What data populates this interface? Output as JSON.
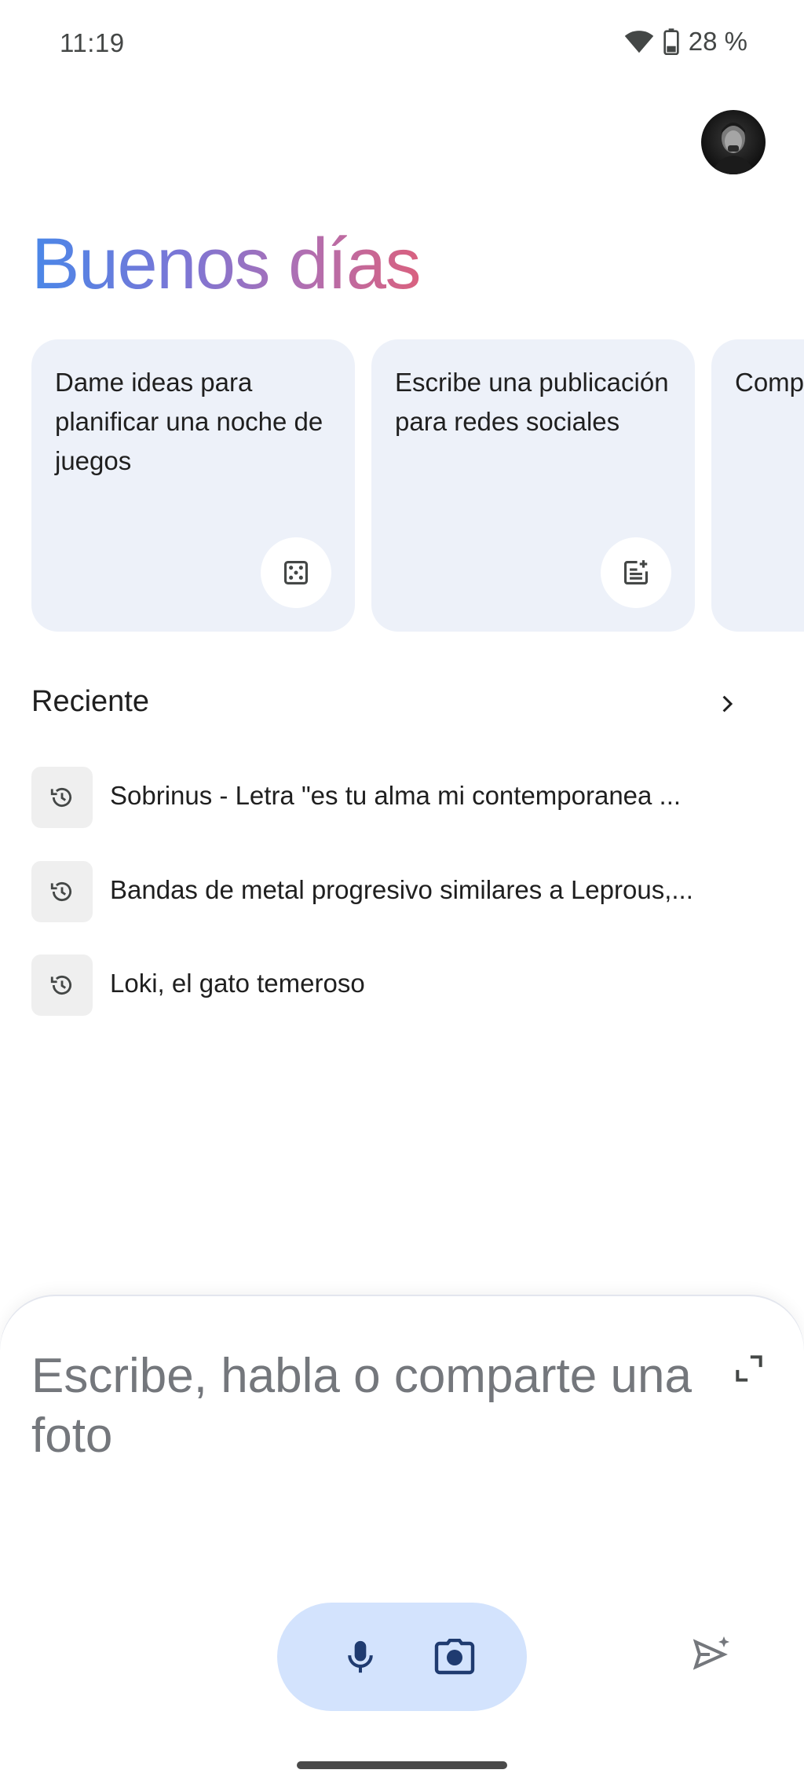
{
  "status_bar": {
    "time": "11:19",
    "battery": "28 %",
    "icons": [
      "wifi-icon",
      "battery-icon"
    ]
  },
  "greeting": "Buenos días",
  "suggestions": [
    {
      "text": "Dame ideas para planificar una noche de juegos",
      "icon": "dice-icon"
    },
    {
      "text": "Escribe una publicación para redes sociales",
      "icon": "post-add-icon"
    },
    {
      "text": "Comp difere opcio",
      "icon": ""
    }
  ],
  "recent": {
    "title": "Reciente",
    "items": [
      {
        "label": "Sobrinus - Letra \"es tu alma mi contemporanea ...",
        "icon": "history-icon"
      },
      {
        "label": "Bandas de metal progresivo similares a Leprous,...",
        "icon": "history-icon"
      },
      {
        "label": "Loki, el gato temeroso",
        "icon": "history-icon"
      }
    ]
  },
  "input": {
    "placeholder": "Escribe, habla o comparte una foto"
  },
  "colors": {
    "card_bg": "#edf1f9",
    "pill_bg": "#d3e3fd",
    "accent": "#1f3b70",
    "greeting_gradient": [
      "#4a87e8",
      "#7a76d6",
      "#b06fb2",
      "#d9617f"
    ]
  }
}
